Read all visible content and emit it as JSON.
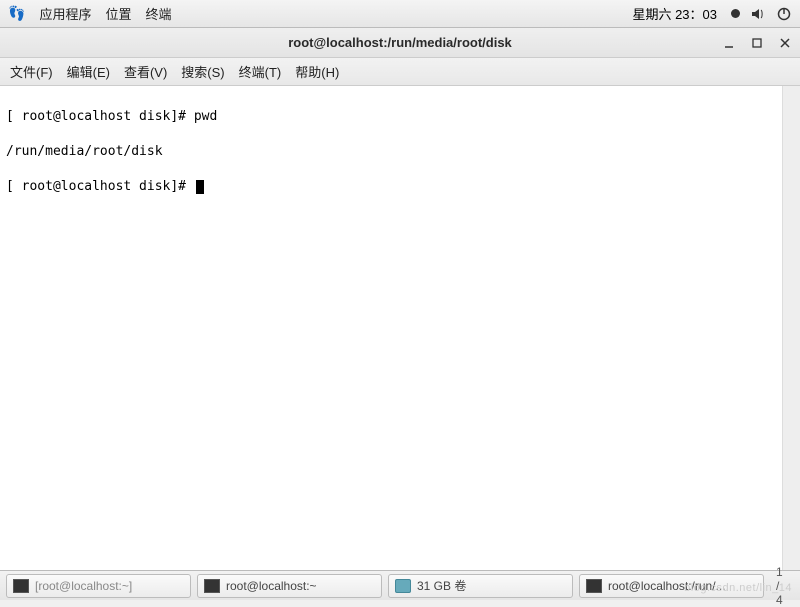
{
  "top_panel": {
    "apps": "应用程序",
    "places": "位置",
    "terminal": "终端",
    "clock": "星期六 23：03",
    "volume_icon": "volume-icon",
    "power_icon": "power-icon"
  },
  "window": {
    "title": "root@localhost:/run/media/root/disk"
  },
  "menu": {
    "file": "文件(F)",
    "edit": "编辑(E)",
    "view": "查看(V)",
    "search": "搜索(S)",
    "terminal": "终端(T)",
    "help": "帮助(H)"
  },
  "terminal": {
    "line1_prompt": "[ root@localhost disk]# ",
    "line1_cmd": "pwd",
    "line2": "/run/media/root/disk",
    "line3_prompt": "[ root@localhost disk]# "
  },
  "taskbar": {
    "item1": "[root@localhost:~]",
    "item2": "root@localhost:~",
    "item3": "31 GB 卷",
    "item4": "root@localhost:/run/...",
    "ws": "1 / 4"
  },
  "watermark": "blog.csdn.net/lin_14"
}
